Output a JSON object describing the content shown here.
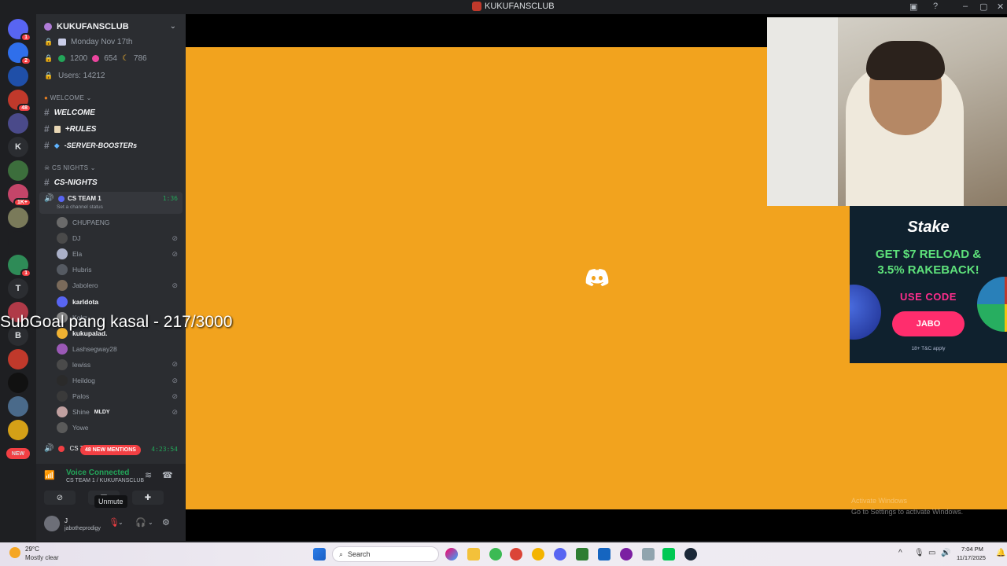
{
  "window": {
    "title": "KUKUFANSCLUB"
  },
  "server": {
    "name": "KUKUFANSCLUB",
    "info_rows": [
      "Monday Nov 17th",
      "",
      "Users: 14212"
    ],
    "stats": {
      "green": "1200",
      "red": "654",
      "moon": "786"
    }
  },
  "server_list": [
    {
      "label": "",
      "badge": "1"
    },
    {
      "label": "",
      "badge": "2"
    },
    {
      "label": "",
      "badge": ""
    },
    {
      "label": "",
      "badge": "48"
    },
    {
      "label": "",
      "badge": ""
    },
    {
      "label": "K",
      "badge": ""
    },
    {
      "label": "",
      "badge": ""
    },
    {
      "label": "",
      "badge": "1K+"
    },
    {
      "label": "",
      "badge": ""
    },
    {
      "label": "",
      "badge": ""
    },
    {
      "label": "",
      "badge": "1"
    },
    {
      "label": "T",
      "badge": ""
    },
    {
      "label": "",
      "badge": ""
    },
    {
      "label": "B",
      "badge": ""
    },
    {
      "label": "",
      "badge": ""
    },
    {
      "label": "",
      "badge": ""
    },
    {
      "label": "",
      "badge": ""
    },
    {
      "label": "",
      "badge": ""
    },
    {
      "label": "NEW",
      "badge": ""
    }
  ],
  "categories": {
    "welcome": "WELCOME",
    "cs_nights": "CS NIGHTS"
  },
  "channels": {
    "welcome": "WELCOME",
    "rules": "+RULES",
    "boosters": "-SERVER-BOOSTERs",
    "cs_nights": "CS-NIGHTS"
  },
  "voice_channel": {
    "name": "CS TEAM 1",
    "timer": "1:36",
    "status_hint": "Set a channel status",
    "members": [
      {
        "name": "CHUPAENG",
        "muted": false,
        "color": "#6a6a6a"
      },
      {
        "name": "DJ",
        "muted": true,
        "color": "#4a4a4a"
      },
      {
        "name": "Ela",
        "muted": true,
        "color": "#aab0c8"
      },
      {
        "name": "Hubris",
        "muted": false,
        "color": "#555a62"
      },
      {
        "name": "Jabolero",
        "muted": true,
        "color": "#7a6a5a"
      },
      {
        "name": "karldota",
        "muted": false,
        "color": "#5865f2",
        "highlight": true
      },
      {
        "name": "Kokz",
        "muted": false,
        "color": "#888"
      },
      {
        "name": "kukupalad.",
        "muted": false,
        "color": "#f0b232",
        "highlight": true
      },
      {
        "name": "Lashsegway28",
        "muted": false,
        "color": "#9b59b6"
      },
      {
        "name": "lewiss",
        "muted": true,
        "color": "#4a4a4a"
      },
      {
        "name": "Heildog",
        "muted": true,
        "color": "#2a2a2a"
      },
      {
        "name": "Palos",
        "muted": true,
        "color": "#3a3a3a"
      },
      {
        "name": "Shine",
        "muted": true,
        "color": "#c0a0a0",
        "tag": "MLDY"
      },
      {
        "name": "Yowe",
        "muted": false,
        "color": "#5a5a5a"
      }
    ],
    "second_timer": "4:23:54",
    "second_prefix": "CS T"
  },
  "mentions_pill": "48 NEW MENTIONS",
  "voice_panel": {
    "status": "Voice Connected",
    "location": "CS TEAM 1 / KUKUFANSCLUB",
    "tooltip": "Unmute"
  },
  "user": {
    "name": "J",
    "tag": "jabotheprodigy"
  },
  "overlay": {
    "subgoal": "SubGoal pang kasal - 217/3000"
  },
  "ad": {
    "brand": "Stake",
    "headline_1": "GET $7 RELOAD &",
    "headline_2": "3.5% RAKEBACK!",
    "use_code": "USE CODE",
    "code": "JABO",
    "fine_print": "18+ T&C apply"
  },
  "watermark": {
    "line1": "Activate Windows",
    "line2": "Go to Settings to activate Windows."
  },
  "taskbar": {
    "weather_temp": "29°C",
    "weather_desc": "Mostly clear",
    "search_placeholder": "Search",
    "time": "7:04 PM",
    "date": "11/17/2025"
  },
  "colors": {
    "stage_orange": "#f2a31e",
    "discord_blurple": "#5865f2",
    "voice_green": "#23a559",
    "mention_red": "#f23f43"
  }
}
